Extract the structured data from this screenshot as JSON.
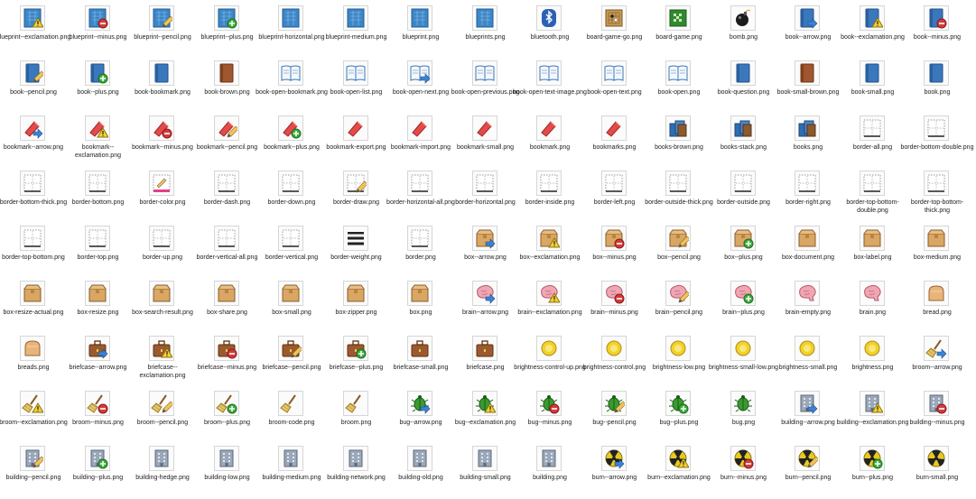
{
  "files": [
    [
      {
        "name": "blueprint--exclamation.png",
        "icon": "blueprint-icon",
        "badge": "warn"
      },
      {
        "name": "blueprint--minus.png",
        "icon": "blueprint-icon",
        "badge": "minus"
      },
      {
        "name": "blueprint--pencil.png",
        "icon": "blueprint-icon",
        "badge": "pencil"
      },
      {
        "name": "blueprint--plus.png",
        "icon": "blueprint-icon",
        "badge": "plus"
      },
      {
        "name": "blueprint-horizontal.png",
        "icon": "blueprint-icon",
        "badge": ""
      },
      {
        "name": "blueprint-medium.png",
        "icon": "blueprint-icon",
        "badge": ""
      },
      {
        "name": "blueprint.png",
        "icon": "blueprint-icon",
        "badge": ""
      },
      {
        "name": "blueprints.png",
        "icon": "blueprint-icon",
        "badge": ""
      },
      {
        "name": "bluetooth.png",
        "icon": "bluetooth-icon",
        "badge": ""
      },
      {
        "name": "board-game-go.png",
        "icon": "board-game-icon",
        "badge": ""
      },
      {
        "name": "board-game.png",
        "icon": "board-game-icon",
        "badge": ""
      },
      {
        "name": "bomb.png",
        "icon": "bomb-icon",
        "badge": ""
      },
      {
        "name": "book--arrow.png",
        "icon": "book-icon",
        "badge": "arrow"
      },
      {
        "name": "book--exclamation.png",
        "icon": "book-icon",
        "badge": "warn"
      },
      {
        "name": "book--minus.png",
        "icon": "book-icon",
        "badge": "minus"
      }
    ],
    [
      {
        "name": "book--pencil.png",
        "icon": "book-icon",
        "badge": "pencil"
      },
      {
        "name": "book--plus.png",
        "icon": "book-icon",
        "badge": "plus"
      },
      {
        "name": "book-bookmark.png",
        "icon": "book-icon",
        "badge": ""
      },
      {
        "name": "book-brown.png",
        "icon": "book-brown-icon",
        "badge": ""
      },
      {
        "name": "book-open-bookmark.png",
        "icon": "book-open-icon",
        "badge": ""
      },
      {
        "name": "book-open-list.png",
        "icon": "book-open-icon",
        "badge": ""
      },
      {
        "name": "book-open-next.png",
        "icon": "book-open-icon",
        "badge": "arrow"
      },
      {
        "name": "book-open-previous.png",
        "icon": "book-open-icon",
        "badge": ""
      },
      {
        "name": "book-open-text-image.png",
        "icon": "book-open-icon",
        "badge": ""
      },
      {
        "name": "book-open-text.png",
        "icon": "book-open-icon",
        "badge": ""
      },
      {
        "name": "book-open.png",
        "icon": "book-open-icon",
        "badge": ""
      },
      {
        "name": "book-question.png",
        "icon": "book-icon",
        "badge": ""
      },
      {
        "name": "book-small-brown.png",
        "icon": "book-brown-icon",
        "badge": ""
      },
      {
        "name": "book-small.png",
        "icon": "book-icon",
        "badge": ""
      },
      {
        "name": "book.png",
        "icon": "book-icon",
        "badge": ""
      }
    ],
    [
      {
        "name": "bookmark--arrow.png",
        "icon": "bookmark-icon",
        "badge": "arrow"
      },
      {
        "name": "bookmark--exclamation.png",
        "icon": "bookmark-icon",
        "badge": "warn"
      },
      {
        "name": "bookmark--minus.png",
        "icon": "bookmark-icon",
        "badge": "minus"
      },
      {
        "name": "bookmark--pencil.png",
        "icon": "bookmark-icon",
        "badge": "pencil"
      },
      {
        "name": "bookmark--plus.png",
        "icon": "bookmark-icon",
        "badge": "plus"
      },
      {
        "name": "bookmark-export.png",
        "icon": "bookmark-icon",
        "badge": ""
      },
      {
        "name": "bookmark-import.png",
        "icon": "bookmark-icon",
        "badge": ""
      },
      {
        "name": "bookmark-small.png",
        "icon": "bookmark-icon",
        "badge": ""
      },
      {
        "name": "bookmark.png",
        "icon": "bookmark-icon",
        "badge": ""
      },
      {
        "name": "bookmarks.png",
        "icon": "bookmark-icon",
        "badge": ""
      },
      {
        "name": "books-brown.png",
        "icon": "books-icon",
        "badge": ""
      },
      {
        "name": "books-stack.png",
        "icon": "books-icon",
        "badge": ""
      },
      {
        "name": "books.png",
        "icon": "books-icon",
        "badge": ""
      },
      {
        "name": "border-all.png",
        "icon": "border-icon",
        "badge": ""
      },
      {
        "name": "border-bottom-double.png",
        "icon": "border-icon",
        "badge": ""
      }
    ],
    [
      {
        "name": "border-bottom-thick.png",
        "icon": "border-icon",
        "badge": ""
      },
      {
        "name": "border-bottom.png",
        "icon": "border-icon",
        "badge": ""
      },
      {
        "name": "border-color.png",
        "icon": "border-color-icon",
        "badge": ""
      },
      {
        "name": "border-dash.png",
        "icon": "border-icon",
        "badge": ""
      },
      {
        "name": "border-down.png",
        "icon": "border-icon",
        "badge": ""
      },
      {
        "name": "border-draw.png",
        "icon": "border-icon",
        "badge": "pencil"
      },
      {
        "name": "border-horizontal-all.png",
        "icon": "border-icon",
        "badge": ""
      },
      {
        "name": "border-horizontal.png",
        "icon": "border-icon",
        "badge": ""
      },
      {
        "name": "border-inside.png",
        "icon": "border-icon",
        "badge": ""
      },
      {
        "name": "border-left.png",
        "icon": "border-icon",
        "badge": ""
      },
      {
        "name": "border-outside-thick.png",
        "icon": "border-icon",
        "badge": ""
      },
      {
        "name": "border-outside.png",
        "icon": "border-icon",
        "badge": ""
      },
      {
        "name": "border-right.png",
        "icon": "border-icon",
        "badge": ""
      },
      {
        "name": "border-top-bottom-double.png",
        "icon": "border-icon",
        "badge": ""
      },
      {
        "name": "border-top-bottom-thick.png",
        "icon": "border-icon",
        "badge": ""
      }
    ],
    [
      {
        "name": "border-top-bottom.png",
        "icon": "border-icon",
        "badge": ""
      },
      {
        "name": "border-top.png",
        "icon": "border-icon",
        "badge": ""
      },
      {
        "name": "border-up.png",
        "icon": "border-icon",
        "badge": ""
      },
      {
        "name": "border-vertical-all.png",
        "icon": "border-icon",
        "badge": ""
      },
      {
        "name": "border-vertical.png",
        "icon": "border-icon",
        "badge": ""
      },
      {
        "name": "border-weight.png",
        "icon": "border-weight-icon",
        "badge": ""
      },
      {
        "name": "border.png",
        "icon": "border-icon",
        "badge": ""
      },
      {
        "name": "box--arrow.png",
        "icon": "box-icon",
        "badge": "arrow"
      },
      {
        "name": "box--exclamation.png",
        "icon": "box-icon",
        "badge": "warn"
      },
      {
        "name": "box--minus.png",
        "icon": "box-icon",
        "badge": "minus"
      },
      {
        "name": "box--pencil.png",
        "icon": "box-icon",
        "badge": "pencil"
      },
      {
        "name": "box--plus.png",
        "icon": "box-icon",
        "badge": "plus"
      },
      {
        "name": "box-document.png",
        "icon": "box-icon",
        "badge": ""
      },
      {
        "name": "box-label.png",
        "icon": "box-icon",
        "badge": ""
      },
      {
        "name": "box-medium.png",
        "icon": "box-icon",
        "badge": ""
      }
    ],
    [
      {
        "name": "box-resize-actual.png",
        "icon": "box-icon",
        "badge": ""
      },
      {
        "name": "box-resize.png",
        "icon": "box-icon",
        "badge": ""
      },
      {
        "name": "box-search-result.png",
        "icon": "box-icon",
        "badge": ""
      },
      {
        "name": "box-share.png",
        "icon": "box-icon",
        "badge": ""
      },
      {
        "name": "box-small.png",
        "icon": "box-icon",
        "badge": ""
      },
      {
        "name": "box-zipper.png",
        "icon": "box-icon",
        "badge": ""
      },
      {
        "name": "box.png",
        "icon": "box-icon",
        "badge": ""
      },
      {
        "name": "brain--arrow.png",
        "icon": "brain-icon",
        "badge": "arrow"
      },
      {
        "name": "brain--exclamation.png",
        "icon": "brain-icon",
        "badge": "warn"
      },
      {
        "name": "brain--minus.png",
        "icon": "brain-icon",
        "badge": "minus"
      },
      {
        "name": "brain--pencil.png",
        "icon": "brain-icon",
        "badge": "pencil"
      },
      {
        "name": "brain--plus.png",
        "icon": "brain-icon",
        "badge": "plus"
      },
      {
        "name": "brain-empty.png",
        "icon": "brain-icon",
        "badge": ""
      },
      {
        "name": "brain.png",
        "icon": "brain-icon",
        "badge": ""
      },
      {
        "name": "bread.png",
        "icon": "bread-icon",
        "badge": ""
      }
    ],
    [
      {
        "name": "breads.png",
        "icon": "bread-icon",
        "badge": ""
      },
      {
        "name": "briefcase--arrow.png",
        "icon": "briefcase-icon",
        "badge": "arrow"
      },
      {
        "name": "briefcase--exclamation.png",
        "icon": "briefcase-icon",
        "badge": "warn"
      },
      {
        "name": "briefcase--minus.png",
        "icon": "briefcase-icon",
        "badge": "minus"
      },
      {
        "name": "briefcase--pencil.png",
        "icon": "briefcase-icon",
        "badge": "pencil"
      },
      {
        "name": "briefcase--plus.png",
        "icon": "briefcase-icon",
        "badge": "plus"
      },
      {
        "name": "briefcase-small.png",
        "icon": "briefcase-icon",
        "badge": ""
      },
      {
        "name": "briefcase.png",
        "icon": "briefcase-icon",
        "badge": ""
      },
      {
        "name": "brightness-control-up.png",
        "icon": "brightness-icon",
        "badge": ""
      },
      {
        "name": "brightness-control.png",
        "icon": "brightness-icon",
        "badge": ""
      },
      {
        "name": "brightness-low.png",
        "icon": "brightness-icon",
        "badge": ""
      },
      {
        "name": "brightness-small-low.png",
        "icon": "brightness-icon",
        "badge": ""
      },
      {
        "name": "brightness-small.png",
        "icon": "brightness-icon",
        "badge": ""
      },
      {
        "name": "brightness.png",
        "icon": "brightness-icon",
        "badge": ""
      },
      {
        "name": "broom--arrow.png",
        "icon": "broom-icon",
        "badge": "arrow"
      }
    ],
    [
      {
        "name": "broom--exclamation.png",
        "icon": "broom-icon",
        "badge": "warn"
      },
      {
        "name": "broom--minus.png",
        "icon": "broom-icon",
        "badge": "minus"
      },
      {
        "name": "broom--pencil.png",
        "icon": "broom-icon",
        "badge": "pencil"
      },
      {
        "name": "broom--plus.png",
        "icon": "broom-icon",
        "badge": "plus"
      },
      {
        "name": "broom-code.png",
        "icon": "broom-icon",
        "badge": ""
      },
      {
        "name": "broom.png",
        "icon": "broom-icon",
        "badge": ""
      },
      {
        "name": "bug--arrow.png",
        "icon": "bug-icon",
        "badge": "arrow"
      },
      {
        "name": "bug--exclamation.png",
        "icon": "bug-icon",
        "badge": "warn"
      },
      {
        "name": "bug--minus.png",
        "icon": "bug-icon",
        "badge": "minus"
      },
      {
        "name": "bug--pencil.png",
        "icon": "bug-icon",
        "badge": "pencil"
      },
      {
        "name": "bug--plus.png",
        "icon": "bug-icon",
        "badge": "plus"
      },
      {
        "name": "bug.png",
        "icon": "bug-icon",
        "badge": ""
      },
      {
        "name": "building--arrow.png",
        "icon": "building-icon",
        "badge": "arrow"
      },
      {
        "name": "building--exclamation.png",
        "icon": "building-icon",
        "badge": "warn"
      },
      {
        "name": "building--minus.png",
        "icon": "building-icon",
        "badge": "minus"
      }
    ],
    [
      {
        "name": "building--pencil.png",
        "icon": "building-icon",
        "badge": "pencil"
      },
      {
        "name": "building--plus.png",
        "icon": "building-icon",
        "badge": "plus"
      },
      {
        "name": "building-hedge.png",
        "icon": "building-icon",
        "badge": ""
      },
      {
        "name": "building-low.png",
        "icon": "building-icon",
        "badge": ""
      },
      {
        "name": "building-medium.png",
        "icon": "building-icon",
        "badge": ""
      },
      {
        "name": "building-network.png",
        "icon": "building-icon",
        "badge": ""
      },
      {
        "name": "building-old.png",
        "icon": "building-icon",
        "badge": ""
      },
      {
        "name": "building-small.png",
        "icon": "building-icon",
        "badge": ""
      },
      {
        "name": "building.png",
        "icon": "building-icon",
        "badge": ""
      },
      {
        "name": "burn--arrow.png",
        "icon": "burn-icon",
        "badge": "arrow"
      },
      {
        "name": "burn--exclamation.png",
        "icon": "burn-icon",
        "badge": "warn"
      },
      {
        "name": "burn--minus.png",
        "icon": "burn-icon",
        "badge": "minus"
      },
      {
        "name": "burn--pencil.png",
        "icon": "burn-icon",
        "badge": "pencil"
      },
      {
        "name": "burn--plus.png",
        "icon": "burn-icon",
        "badge": "plus"
      },
      {
        "name": "burn-small.png",
        "icon": "burn-icon",
        "badge": ""
      }
    ]
  ]
}
